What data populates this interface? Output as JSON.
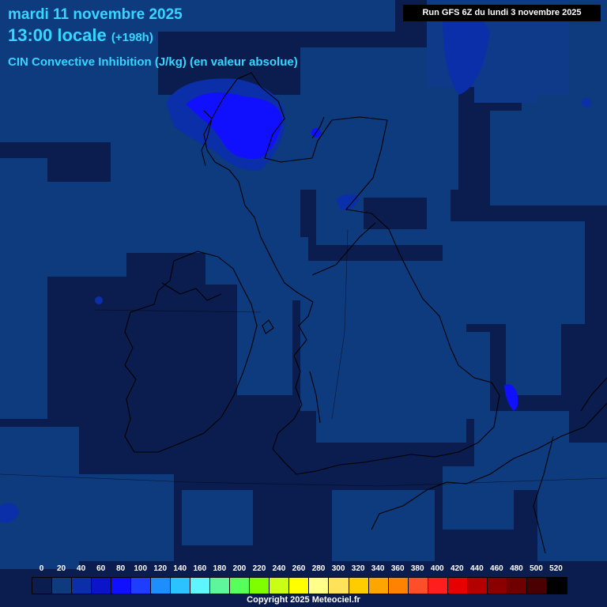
{
  "header": {
    "date": "mardi 11 novembre 2025",
    "time": "13:00 locale",
    "offset": "(+198h)",
    "parameter": "CIN Convective Inhibition (J/kg) (en valeur absolue)",
    "run": "Run GFS 6Z du lundi 3 novembre 2025"
  },
  "legend": {
    "ticks": [
      "0",
      "20",
      "40",
      "60",
      "80",
      "100",
      "120",
      "140",
      "160",
      "180",
      "200",
      "220",
      "240",
      "260",
      "280",
      "300",
      "320",
      "340",
      "360",
      "380",
      "400",
      "420",
      "440",
      "460",
      "480",
      "500",
      "520"
    ],
    "colors": [
      "#0b1d4f",
      "#0e3a7e",
      "#0b2fa8",
      "#0a14c8",
      "#1010ff",
      "#1f3dff",
      "#1e8eff",
      "#2cc2ff",
      "#5ef5ff",
      "#5ff59c",
      "#56ff5a",
      "#7dff00",
      "#c8ff14",
      "#ffff00",
      "#ffff8a",
      "#ffe25b",
      "#ffcc00",
      "#ffa500",
      "#ff8200",
      "#ff4f26",
      "#ff1e1e",
      "#e60000",
      "#b50000",
      "#8a0000",
      "#6e0000",
      "#4a0000",
      "#000000"
    ]
  },
  "copyright": "Copyright 2025 Meteociel.fr",
  "colors": {
    "background": "#0b1d4f",
    "field": "#0e3a7e",
    "highlight": "#1010ff",
    "title": "#35d6ff"
  }
}
